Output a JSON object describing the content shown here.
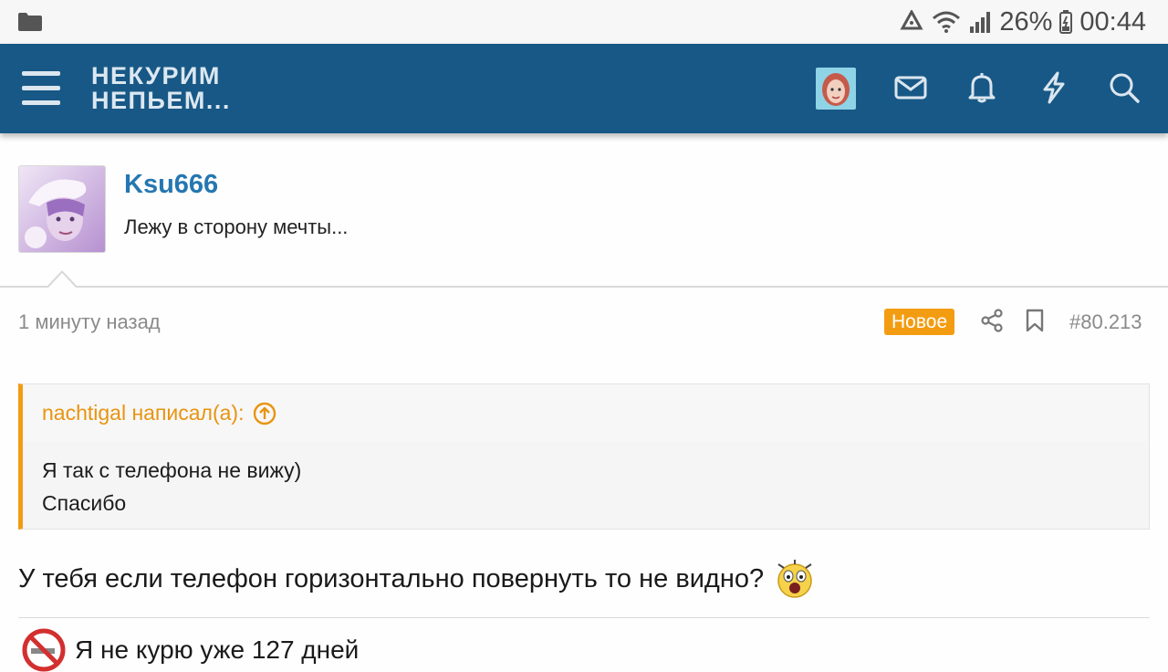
{
  "status_bar": {
    "battery": "26%",
    "time": "00:44",
    "icons": [
      "folder-icon",
      "recycle-icon",
      "wifi-icon",
      "signal-icon",
      "battery-icon"
    ]
  },
  "header": {
    "logo_line1": "НЕКУРИМ",
    "logo_line2": "НЕПЬЕМ...",
    "background": "#185886",
    "icons": [
      "menu-icon",
      "user-avatar",
      "mail-icon",
      "bell-icon",
      "lightning-icon",
      "search-icon"
    ]
  },
  "post": {
    "author": "Ksu666",
    "author_title": "Лежу в сторону мечты...",
    "time": "1 минуту назад",
    "badge": "Новое",
    "number": "#80.213",
    "quote": {
      "author": "nachtigal написал(а):",
      "lines": [
        "Я так с телефона не вижу)",
        "Спасибо"
      ]
    },
    "message": "У тебя если телефон горизонтально повернуть то не видно?",
    "signature": "Я не курю уже 127 дней"
  },
  "colors": {
    "accent": "#f39c12",
    "link": "#2577b1",
    "header": "#185886"
  }
}
